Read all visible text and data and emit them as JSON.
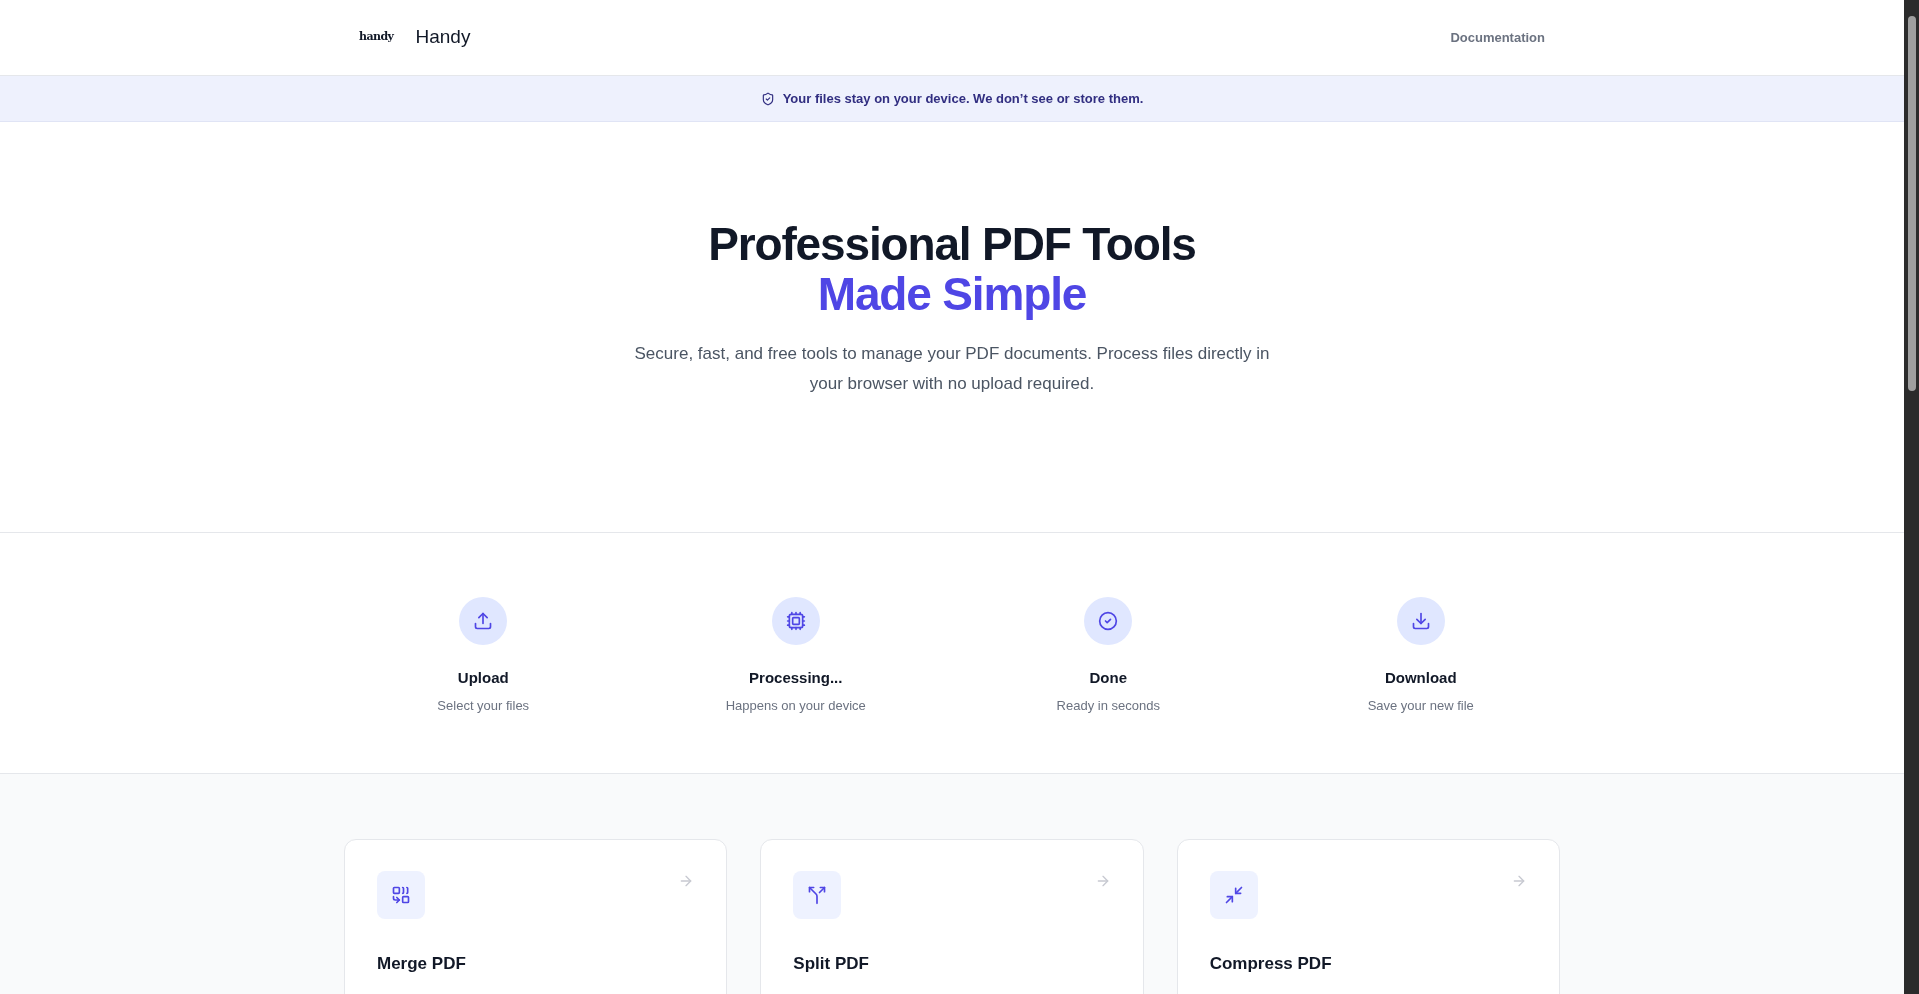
{
  "header": {
    "logo": "handy",
    "brand": "Handy",
    "nav": [
      "Documentation"
    ]
  },
  "banner": {
    "text": "Your files stay on your device. We don’t see or store them."
  },
  "hero": {
    "title": "Professional PDF Tools",
    "highlight": "Made Simple",
    "subtitle": "Secure, fast, and free tools to manage your PDF documents. Process files directly in your browser with no upload required."
  },
  "steps": [
    {
      "kind": "upload",
      "title": "Upload",
      "caption": "Select your files"
    },
    {
      "kind": "processing",
      "title": "Processing...",
      "caption": "Happens on your device"
    },
    {
      "kind": "done",
      "title": "Done",
      "caption": "Ready in seconds"
    },
    {
      "kind": "download",
      "title": "Download",
      "caption": "Save your new file"
    }
  ],
  "tools": [
    {
      "kind": "merge",
      "title": "Merge PDF"
    },
    {
      "kind": "split",
      "title": "Split PDF"
    },
    {
      "kind": "compress",
      "title": "Compress PDF"
    }
  ]
}
